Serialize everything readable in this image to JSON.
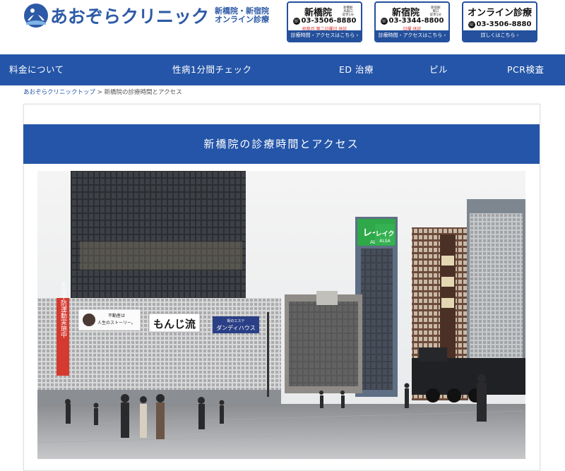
{
  "header": {
    "logo_name": "あおぞらクリニック",
    "logo_sub_line1": "新橋院・新宿院",
    "logo_sub_line2": "オンライン診療",
    "clinics": [
      {
        "title": "新橋院",
        "note": "新橋駅\n烏森口\n徒歩1分",
        "tel": "03-3506-8880",
        "holiday": "祝祭月 第二日曜日 休診",
        "link": "診療時間・アクセスはこちら ›"
      },
      {
        "title": "新宿院",
        "note": "新宿駅\n東口\n徒歩1分",
        "tel": "03-3344-8800",
        "holiday": "日曜 休診",
        "link": "診療時間・アクセスはこちら ›"
      },
      {
        "title": "オンライン診療",
        "note": "",
        "tel": "03-3506-8880",
        "holiday": "",
        "link": "詳しくはこちら ›"
      }
    ]
  },
  "nav": {
    "items": [
      "料金について",
      "性病1分間チェック",
      "ED 治療",
      "ピル",
      "PCR検査"
    ]
  },
  "breadcrumb": {
    "home": "あおぞらクリニックトップ",
    "separator": ">",
    "current": "新橋院の診療時間とアクセス"
  },
  "main": {
    "title": "新橋院の診療時間とアクセス",
    "photo_signs": {
      "fire_banner": "火災予防運動実施中",
      "billboard_line1": "不動産は",
      "billboard_line2": "人生のストーリー。",
      "monjiro": "もんじ流",
      "dandy_small": "街のエステ",
      "dandy_big": "ダンディハウス",
      "lake_top": "レイク",
      "lake_bottom": "ALSA",
      "lake2_top": "レイク",
      "lake2_bottom": "ALSA"
    }
  },
  "colors": {
    "brand": "#2455a8",
    "holiday_red": "#d0312d"
  }
}
